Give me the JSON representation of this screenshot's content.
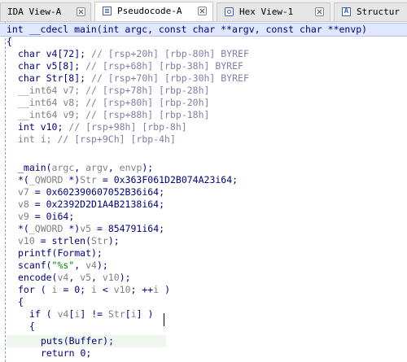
{
  "tabs": [
    {
      "label": "IDA View-A",
      "icon": "document-icon",
      "active": false
    },
    {
      "label": "Pseudocode-A",
      "icon": "document-icon",
      "active": true
    },
    {
      "label": "Hex View-1",
      "icon": "hex-icon",
      "active": false
    },
    {
      "label": "Structur",
      "icon": "structures-icon",
      "active": false
    }
  ],
  "code": {
    "l0": "int __cdecl main(int argc, const char **argv, const char **envp)",
    "l1": "{",
    "l2a": "char v4[72]; ",
    "l2b": "// [rsp+20h] [rbp-80h] BYREF",
    "l3a": "char v5[8]; ",
    "l3b": "// [rsp+68h] [rbp-38h] BYREF",
    "l4a": "char Str[8]; ",
    "l4b": "// [rsp+70h] [rbp-30h] BYREF",
    "l5a": "__int64 v7; ",
    "l5b": "// [rsp+78h] [rbp-28h]",
    "l6a": "__int64 v8; ",
    "l6b": "// [rsp+80h] [rbp-20h]",
    "l7a": "__int64 v9; ",
    "l7b": "// [rsp+88h] [rbp-18h]",
    "l8a": "int v10; ",
    "l8b": "// [rsp+98h] [rbp-8h]",
    "l9a": "int i; ",
    "l9b": "// [rsp+9Ch] [rbp-4h]",
    "l11a": "_main(",
    "l11b": "argc",
    "l11c": ", ",
    "l11d": "argv",
    "l11e": ", ",
    "l11f": "envp",
    "l11g": ");",
    "l12a": "*(",
    "l12b": "_QWORD",
    "l12c": " *)",
    "l12d": "Str",
    "l12e": " = 0x363F061D2B074A23i64;",
    "l13a": "v7",
    "l13b": " = 0x602390607052B36i64;",
    "l14a": "v8",
    "l14b": " = 0x2392D2D1A4B2138i64;",
    "l15a": "v9",
    "l15b": " = 0i64;",
    "l16a": "*(",
    "l16b": "_QWORD",
    "l16c": " *)",
    "l16d": "v5",
    "l16e": " = 854791i64;",
    "l17a": "v10",
    "l17b": " = strlen(",
    "l17c": "Str",
    "l17d": ");",
    "l18a": "printf(Format);",
    "l19a": "scanf(",
    "l19b": "\"%s\"",
    "l19c": ", ",
    "l19d": "v4",
    "l19e": ");",
    "l20a": "encode(",
    "l20b": "v4",
    "l20c": ", ",
    "l20d": "v5",
    "l20e": ", ",
    "l20f": "v10",
    "l20g": ");",
    "l21a": "for ( ",
    "l21b": "i",
    "l21c": " = 0; ",
    "l21d": "i",
    "l21e": " < ",
    "l21f": "v10",
    "l21g": "; ++",
    "l21h": "i",
    "l21i": " )",
    "l22": "{",
    "l23a": "if ( ",
    "l23b": "v4",
    "l23c": "[",
    "l23d": "i",
    "l23e": "] != ",
    "l23f": "Str",
    "l23g": "[",
    "l23h": "i",
    "l23i": "] )",
    "l24": "{",
    "l25": "puts(Buffer);",
    "l26": "return 0;"
  },
  "colors": {
    "code_text": "#000080",
    "comment": "#7e7ea8",
    "string": "#008000",
    "variable_gray": "#808080",
    "tab_active": "#ffffff",
    "tab_inactive": "#e6e6e6"
  }
}
